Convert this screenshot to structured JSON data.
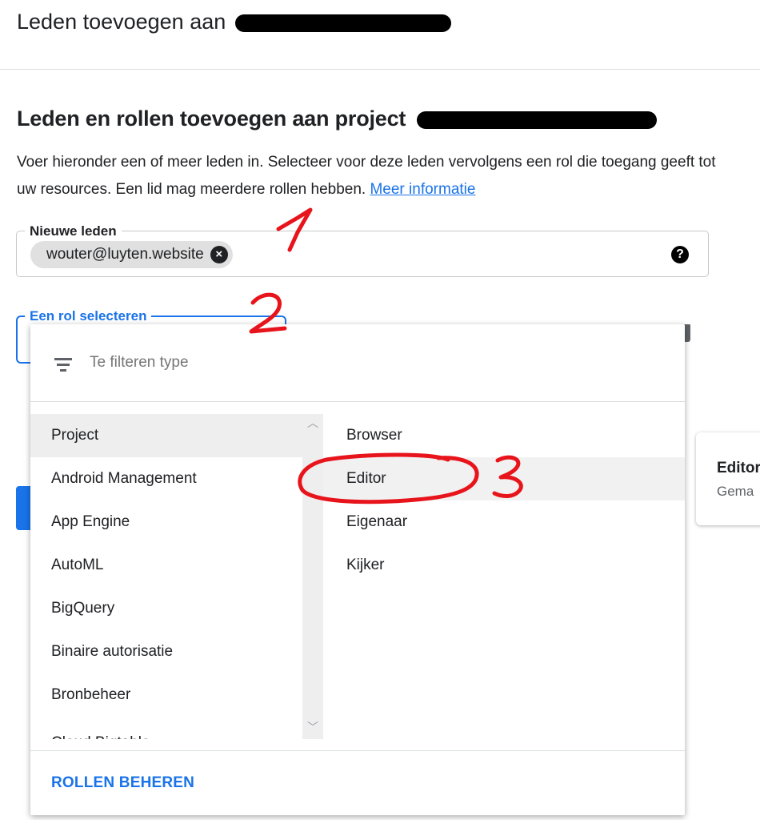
{
  "header": {
    "title": "Leden toevoegen aan"
  },
  "section": {
    "heading": "Leden en rollen toevoegen aan project",
    "description": "Voer hieronder een of meer leden in. Selecteer voor deze leden vervolgens een rol die toegang geeft tot uw resources. Een lid mag meerdere rollen hebben.",
    "more_info_link": "Meer informatie"
  },
  "members_field": {
    "label": "Nieuwe leden",
    "chips": [
      "wouter@luyten.website"
    ],
    "help_icon": "help-circle-icon"
  },
  "role_select": {
    "label": "Een rol selecteren"
  },
  "role_menu": {
    "filter_placeholder": "Te filteren type",
    "categories": [
      "Project",
      "Android Management",
      "App Engine",
      "AutoML",
      "BigQuery",
      "Binaire autorisatie",
      "Bronbeheer",
      "Cloud Bigtable"
    ],
    "selected_category": "Project",
    "roles": [
      "Browser",
      "Editor",
      "Eigenaar",
      "Kijker"
    ],
    "hovered_role": "Editor",
    "manage_roles_label": "ROLLEN BEHEREN"
  },
  "role_card": {
    "title": "Editor",
    "description": "Gema"
  },
  "annotations": [
    "1",
    "2",
    "3"
  ],
  "colors": {
    "accent": "#1a73e8",
    "annotation": "#e8141c",
    "text": "#202124"
  }
}
